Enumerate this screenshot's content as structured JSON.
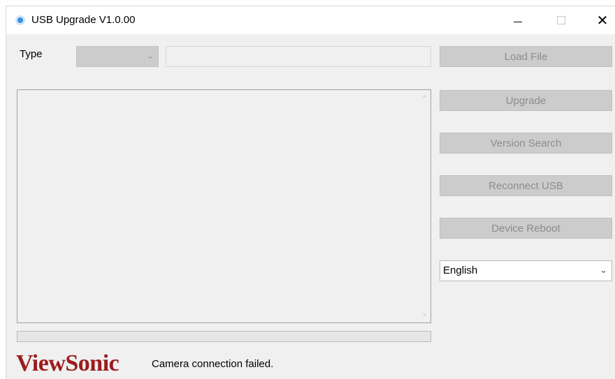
{
  "window": {
    "title": "USB Upgrade V1.0.00",
    "controls": {
      "minimize": "—",
      "maximize": "□",
      "close": "✕"
    }
  },
  "form": {
    "type_label": "Type",
    "type_value": "",
    "file_path": ""
  },
  "buttons": {
    "load_file": "Load File",
    "upgrade": "Upgrade",
    "version_search": "Version Search",
    "reconnect_usb": "Reconnect USB",
    "device_reboot": "Device Reboot"
  },
  "language": {
    "selected": "English"
  },
  "log": {
    "text": ""
  },
  "progress": {
    "percent": 0
  },
  "footer": {
    "logo": "ViewSonic",
    "status": "Camera connection failed."
  },
  "colors": {
    "logo": "#9b1c1c",
    "button_bg": "#cccccc",
    "button_text": "#8c8c8c"
  },
  "icons": {
    "app": "app-disc-icon",
    "dropdown": "chevron-down-icon",
    "scroll_up": "chevron-up-icon",
    "scroll_down": "chevron-down-icon"
  }
}
